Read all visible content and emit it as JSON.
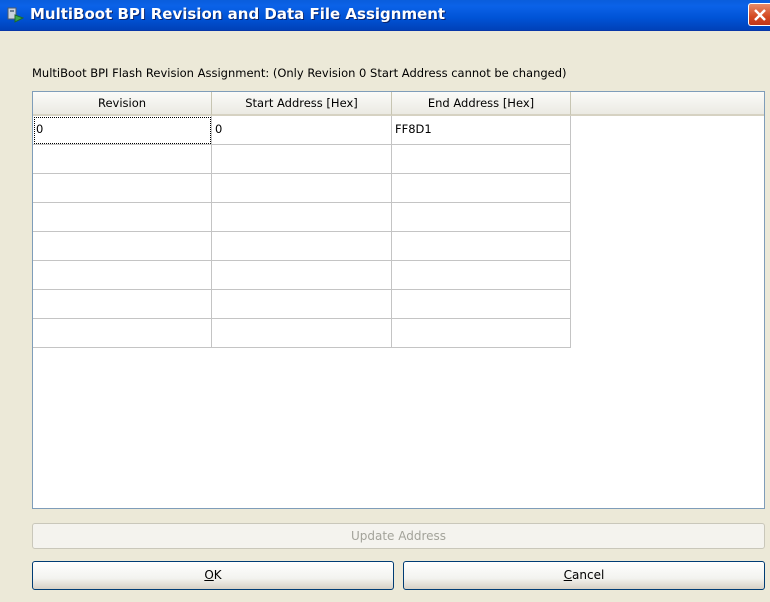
{
  "window": {
    "title": "MultiBoot BPI Revision and Data File Assignment"
  },
  "section_label": "MultiBoot BPI Flash Revision Assignment: (Only Revision 0 Start Address cannot be changed)",
  "table": {
    "columns": [
      "Revision",
      "Start Address [Hex]",
      "End Address [Hex]",
      ""
    ],
    "rows": [
      [
        "0",
        "0",
        "FF8D1"
      ],
      [
        "",
        "",
        ""
      ],
      [
        "",
        "",
        ""
      ],
      [
        "",
        "",
        ""
      ],
      [
        "",
        "",
        ""
      ],
      [
        "",
        "",
        ""
      ],
      [
        "",
        "",
        ""
      ],
      [
        "",
        "",
        ""
      ]
    ]
  },
  "buttons": {
    "update": "Update Address",
    "ok_accel": "O",
    "ok_rest": "K",
    "cancel_accel": "C",
    "cancel_rest": "ancel"
  },
  "colors": {
    "titlebar": "#0053d6",
    "window_bg": "#ece9d8",
    "close_button": "#d44a22"
  },
  "icons": {
    "app": "multiboot-app-icon",
    "close": "close-icon"
  }
}
